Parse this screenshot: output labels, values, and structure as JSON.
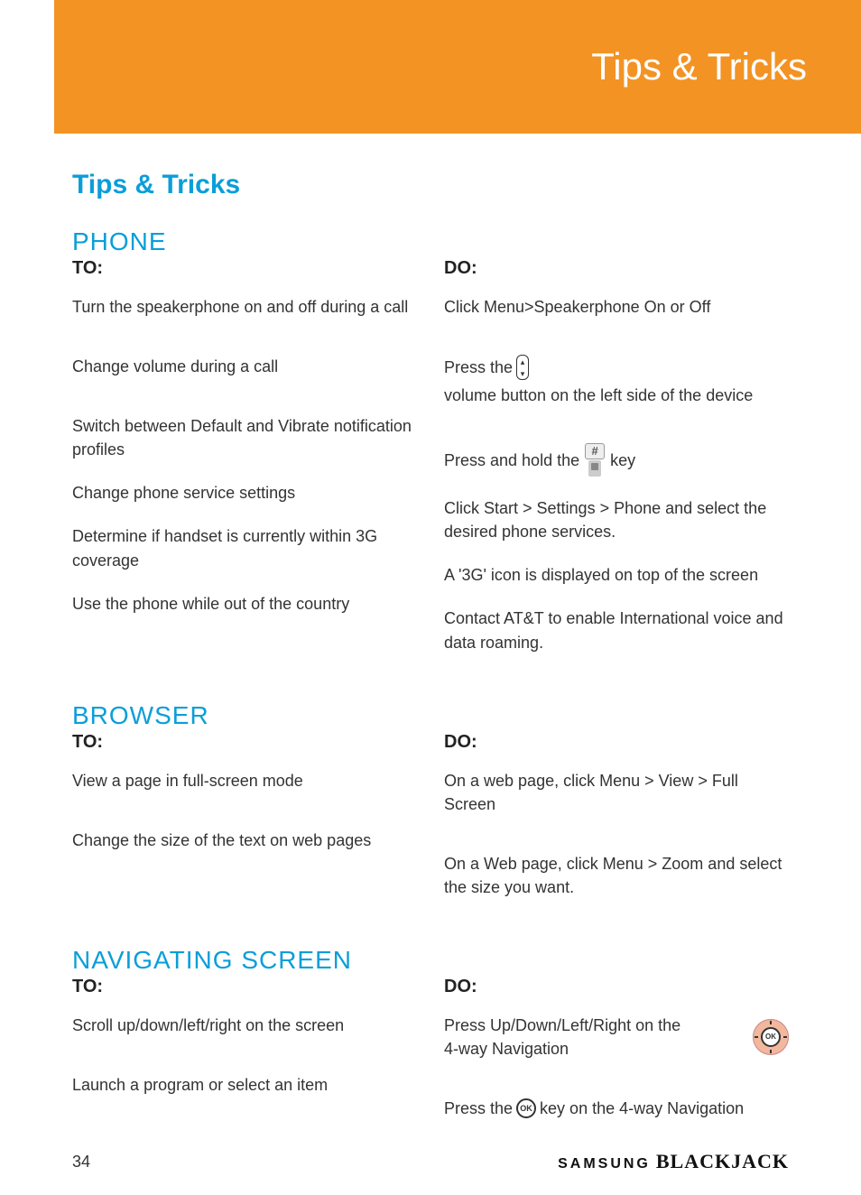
{
  "header": {
    "title": "Tips & Tricks"
  },
  "page": {
    "title": "Tips & Tricks",
    "number": "34"
  },
  "labels": {
    "to": "TO:",
    "do": "DO:"
  },
  "sections": {
    "phone": {
      "title": "PHONE",
      "rows": [
        {
          "to": "Turn the speakerphone on and off during a call",
          "do": "Click Menu>Speakerphone On or Off"
        },
        {
          "to": "Change volume during a call",
          "do_pre": "Press the",
          "do_post": "volume button on the left side of the device",
          "icon": "volume"
        },
        {
          "to": "Switch between Default and Vibrate notification profiles",
          "do_pre": "Press and hold the",
          "do_post": "key",
          "icon": "hash"
        },
        {
          "to": "Change phone service settings",
          "do": "Click Start > Settings > Phone and select the desired phone services."
        },
        {
          "to": "Determine if handset is currently within 3G coverage",
          "do": "A '3G' icon is displayed on top of the screen"
        },
        {
          "to": "Use the phone while out of the country",
          "do": "Contact AT&T to enable International voice and data roaming."
        }
      ]
    },
    "browser": {
      "title": "BROWSER",
      "rows": [
        {
          "to": "View a page in full-screen mode",
          "do": "On a web page, click Menu > View > Full Screen"
        },
        {
          "to": "Change the size of the text on web pages",
          "do": "On a Web page, click Menu > Zoom and select the size you want."
        }
      ]
    },
    "nav": {
      "title": "NAVIGATING SCREEN",
      "rows": [
        {
          "to": "Scroll up/down/left/right on the screen",
          "do_pre": "Press Up/Down/Left/Right on the 4-way Navigation",
          "do_post": "",
          "icon": "nav"
        },
        {
          "to": "Launch a program or select an item",
          "do_pre": "Press the",
          "do_post": "key on the 4-way Navigation",
          "icon": "ok-small"
        }
      ]
    }
  },
  "footer": {
    "brand1": "SAMSUNG",
    "brand2": "BLACKJACK"
  }
}
